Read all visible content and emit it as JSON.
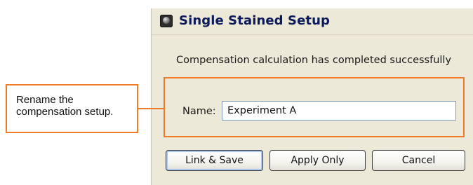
{
  "dialog": {
    "title": "Single Stained Setup",
    "icon": "app-icon",
    "message": "Compensation calculation has completed successfully",
    "name_label": "Name:",
    "name_value": "Experiment A",
    "buttons": {
      "link_save": "Link & Save",
      "apply_only": "Apply Only",
      "cancel": "Cancel"
    }
  },
  "annotation": {
    "callout_line1": "Rename the",
    "callout_line2": "compensation setup.",
    "color": "#f07c2a"
  }
}
